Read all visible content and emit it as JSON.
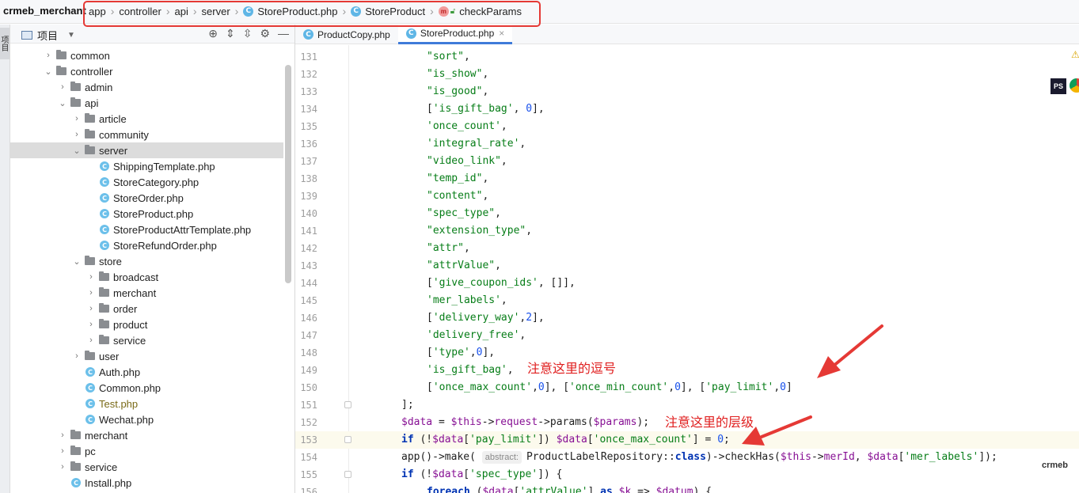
{
  "navbar": {
    "project": "crmeb_merchant",
    "crumbs": [
      "app",
      "controller",
      "api",
      "server"
    ],
    "file": "StoreProduct.php",
    "class": "StoreProduct",
    "method_badge": "m",
    "method": "checkParams"
  },
  "project_panel": {
    "title": "项目",
    "side_tab": "项目",
    "tree": [
      {
        "label": "common",
        "type": "folder",
        "depth": 3,
        "expanded": false
      },
      {
        "label": "controller",
        "type": "folder",
        "depth": 3,
        "expanded": true
      },
      {
        "label": "admin",
        "type": "folder",
        "depth": 4,
        "expanded": false
      },
      {
        "label": "api",
        "type": "folder",
        "depth": 4,
        "expanded": true
      },
      {
        "label": "article",
        "type": "folder",
        "depth": 5,
        "expanded": false
      },
      {
        "label": "community",
        "type": "folder",
        "depth": 5,
        "expanded": false
      },
      {
        "label": "server",
        "type": "folder",
        "depth": 5,
        "expanded": true,
        "selected": true
      },
      {
        "label": "ShippingTemplate.php",
        "type": "file",
        "depth": 6
      },
      {
        "label": "StoreCategory.php",
        "type": "file",
        "depth": 6
      },
      {
        "label": "StoreOrder.php",
        "type": "file",
        "depth": 6
      },
      {
        "label": "StoreProduct.php",
        "type": "file",
        "depth": 6
      },
      {
        "label": "StoreProductAttrTemplate.php",
        "type": "file",
        "depth": 6
      },
      {
        "label": "StoreRefundOrder.php",
        "type": "file",
        "depth": 6
      },
      {
        "label": "store",
        "type": "folder",
        "depth": 5,
        "expanded": true
      },
      {
        "label": "broadcast",
        "type": "folder",
        "depth": 6,
        "expanded": false
      },
      {
        "label": "merchant",
        "type": "folder",
        "depth": 6,
        "expanded": false
      },
      {
        "label": "order",
        "type": "folder",
        "depth": 6,
        "expanded": false
      },
      {
        "label": "product",
        "type": "folder",
        "depth": 6,
        "expanded": false
      },
      {
        "label": "service",
        "type": "folder",
        "depth": 6,
        "expanded": false
      },
      {
        "label": "user",
        "type": "folder",
        "depth": 5,
        "expanded": false
      },
      {
        "label": "Auth.php",
        "type": "file",
        "depth": 5
      },
      {
        "label": "Common.php",
        "type": "file",
        "depth": 5
      },
      {
        "label": "Test.php",
        "type": "file",
        "depth": 5,
        "modified": true
      },
      {
        "label": "Wechat.php",
        "type": "file",
        "depth": 5
      },
      {
        "label": "merchant",
        "type": "folder",
        "depth": 4,
        "expanded": false
      },
      {
        "label": "pc",
        "type": "folder",
        "depth": 4,
        "expanded": false
      },
      {
        "label": "service",
        "type": "folder",
        "depth": 4,
        "expanded": false
      },
      {
        "label": "Install.php",
        "type": "file",
        "depth": 4
      }
    ]
  },
  "tabs": [
    {
      "label": "ProductCopy.php",
      "active": false
    },
    {
      "label": "StoreProduct.php",
      "active": true
    }
  ],
  "editor": {
    "current_line": 153,
    "lines": [
      {
        "n": "131",
        "tokens": [
          [
            "s",
            "\"sort\""
          ],
          [
            "p",
            ","
          ]
        ]
      },
      {
        "n": "132",
        "tokens": [
          [
            "s",
            "\"is_show\""
          ],
          [
            "p",
            ","
          ]
        ]
      },
      {
        "n": "133",
        "tokens": [
          [
            "s",
            "\"is_good\""
          ],
          [
            "p",
            ","
          ]
        ]
      },
      {
        "n": "134",
        "tokens": [
          [
            "p",
            "["
          ],
          [
            "s",
            "'is_gift_bag'"
          ],
          [
            "p",
            ", "
          ],
          [
            "n",
            "0"
          ],
          [
            "p",
            "],"
          ]
        ]
      },
      {
        "n": "135",
        "tokens": [
          [
            "s",
            "'once_count'"
          ],
          [
            "p",
            ","
          ]
        ]
      },
      {
        "n": "136",
        "tokens": [
          [
            "s",
            "'integral_rate'"
          ],
          [
            "p",
            ","
          ]
        ]
      },
      {
        "n": "137",
        "tokens": [
          [
            "s",
            "\"video_link\""
          ],
          [
            "p",
            ","
          ]
        ]
      },
      {
        "n": "138",
        "tokens": [
          [
            "s",
            "\"temp_id\""
          ],
          [
            "p",
            ","
          ]
        ]
      },
      {
        "n": "139",
        "tokens": [
          [
            "s",
            "\"content\""
          ],
          [
            "p",
            ","
          ]
        ]
      },
      {
        "n": "140",
        "tokens": [
          [
            "s",
            "\"spec_type\""
          ],
          [
            "p",
            ","
          ]
        ]
      },
      {
        "n": "141",
        "tokens": [
          [
            "s",
            "\"extension_type\""
          ],
          [
            "p",
            ","
          ]
        ]
      },
      {
        "n": "142",
        "tokens": [
          [
            "s",
            "\"attr\""
          ],
          [
            "p",
            ","
          ]
        ]
      },
      {
        "n": "143",
        "tokens": [
          [
            "s",
            "\"attrValue\""
          ],
          [
            "p",
            ","
          ]
        ]
      },
      {
        "n": "144",
        "tokens": [
          [
            "p",
            "["
          ],
          [
            "s",
            "'give_coupon_ids'"
          ],
          [
            "p",
            ", []],"
          ]
        ]
      },
      {
        "n": "145",
        "tokens": [
          [
            "s",
            "'mer_labels'"
          ],
          [
            "p",
            ","
          ]
        ]
      },
      {
        "n": "146",
        "tokens": [
          [
            "p",
            "["
          ],
          [
            "s",
            "'delivery_way'"
          ],
          [
            "p",
            ","
          ],
          [
            "n",
            "2"
          ],
          [
            "p",
            "],"
          ]
        ]
      },
      {
        "n": "147",
        "tokens": [
          [
            "s",
            "'delivery_free'"
          ],
          [
            "p",
            ","
          ]
        ]
      },
      {
        "n": "148",
        "tokens": [
          [
            "p",
            "["
          ],
          [
            "s",
            "'type'"
          ],
          [
            "p",
            ","
          ],
          [
            "n",
            "0"
          ],
          [
            "p",
            "],"
          ]
        ]
      },
      {
        "n": "149",
        "tokens": [
          [
            "s",
            "'is_gift_bag'"
          ],
          [
            "p",
            ","
          ]
        ]
      },
      {
        "n": "150",
        "tokens": [
          [
            "p",
            "["
          ],
          [
            "s",
            "'once_max_count'"
          ],
          [
            "p",
            ","
          ],
          [
            "n",
            "0"
          ],
          [
            "p",
            "], ["
          ],
          [
            "s",
            "'once_min_count'"
          ],
          [
            "p",
            ","
          ],
          [
            "n",
            "0"
          ],
          [
            "p",
            "], ["
          ],
          [
            "s",
            "'pay_limit'"
          ],
          [
            "p",
            ","
          ],
          [
            "n",
            "0"
          ],
          [
            "p",
            "]"
          ]
        ]
      },
      {
        "n": "151",
        "tokens": [
          [
            "p",
            "];"
          ]
        ]
      },
      {
        "n": "152",
        "tokens": [
          [
            "v",
            "$data"
          ],
          [
            "p",
            " = "
          ],
          [
            "v",
            "$this"
          ],
          [
            "p",
            "->"
          ],
          [
            "v",
            "request"
          ],
          [
            "p",
            "->params("
          ],
          [
            "v",
            "$params"
          ],
          [
            "p",
            ");"
          ]
        ]
      },
      {
        "n": "153",
        "tokens": [
          [
            "k",
            "if"
          ],
          [
            "p",
            " (!"
          ],
          [
            "v",
            "$data"
          ],
          [
            "p",
            "["
          ],
          [
            "s",
            "'pay_limit'"
          ],
          [
            "p",
            "]) "
          ],
          [
            "v",
            "$data"
          ],
          [
            "p",
            "["
          ],
          [
            "s",
            "'once_max_count'"
          ],
          [
            "p",
            "] = "
          ],
          [
            "n",
            "0"
          ],
          [
            "p",
            ";"
          ]
        ]
      },
      {
        "n": "154",
        "tokens": [
          [
            "p",
            "app()->make( "
          ],
          [
            "h",
            "abstract:"
          ],
          [
            "p",
            "ProductLabelRepository::"
          ],
          [
            "k",
            "class"
          ],
          [
            "p",
            ")->checkHas("
          ],
          [
            "v",
            "$this"
          ],
          [
            "p",
            "->"
          ],
          [
            "v",
            "merId"
          ],
          [
            "p",
            ", "
          ],
          [
            "v",
            "$data"
          ],
          [
            "p",
            "["
          ],
          [
            "s",
            "'mer_labels'"
          ],
          [
            "p",
            "]);"
          ]
        ]
      },
      {
        "n": "155",
        "tokens": [
          [
            "k",
            "if"
          ],
          [
            "p",
            " (!"
          ],
          [
            "v",
            "$data"
          ],
          [
            "p",
            "["
          ],
          [
            "s",
            "'spec_type'"
          ],
          [
            "p",
            "]) {"
          ]
        ]
      },
      {
        "n": "156",
        "tokens": [
          [
            "k",
            "foreach"
          ],
          [
            "p",
            " ("
          ],
          [
            "v",
            "$data"
          ],
          [
            "p",
            "["
          ],
          [
            "s",
            "'attrValue'"
          ],
          [
            "p",
            "] "
          ],
          [
            "k",
            "as"
          ],
          [
            "p",
            " "
          ],
          [
            "v",
            "$k"
          ],
          [
            "p",
            " => "
          ],
          [
            "v",
            "$datum"
          ],
          [
            "p",
            ") {"
          ]
        ]
      }
    ]
  },
  "annotations": {
    "comma_note": "注意这里的逗号",
    "level_note": "注意这里的层级"
  },
  "right_icons": {
    "ps": "PS"
  },
  "watermark": "crmeb"
}
